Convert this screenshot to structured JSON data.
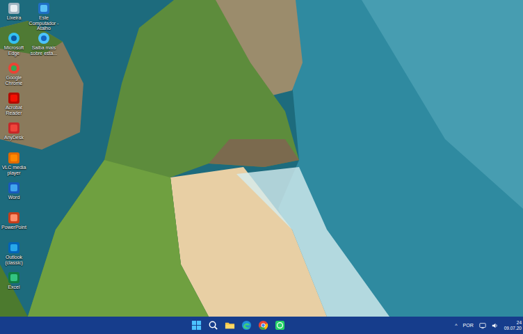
{
  "desktop": {
    "icons": [
      {
        "label": "Lixeira"
      },
      {
        "label": "Microsoft Edge"
      },
      {
        "label": "Google Chrome"
      },
      {
        "label": "Acrobat Reader"
      },
      {
        "label": "AnyDesk"
      },
      {
        "label": "VLC media player"
      },
      {
        "label": "Word"
      },
      {
        "label": "PowerPoint"
      },
      {
        "label": "Outlook (classic)"
      },
      {
        "label": "Excel"
      },
      {
        "label": "Este Computador - Atalho"
      },
      {
        "label": "Saiba mais sobre esta..."
      }
    ]
  },
  "taskbar": {
    "tray": {
      "chevron": "^",
      "language": "POR",
      "time": "24",
      "date": "09.07.20"
    }
  }
}
